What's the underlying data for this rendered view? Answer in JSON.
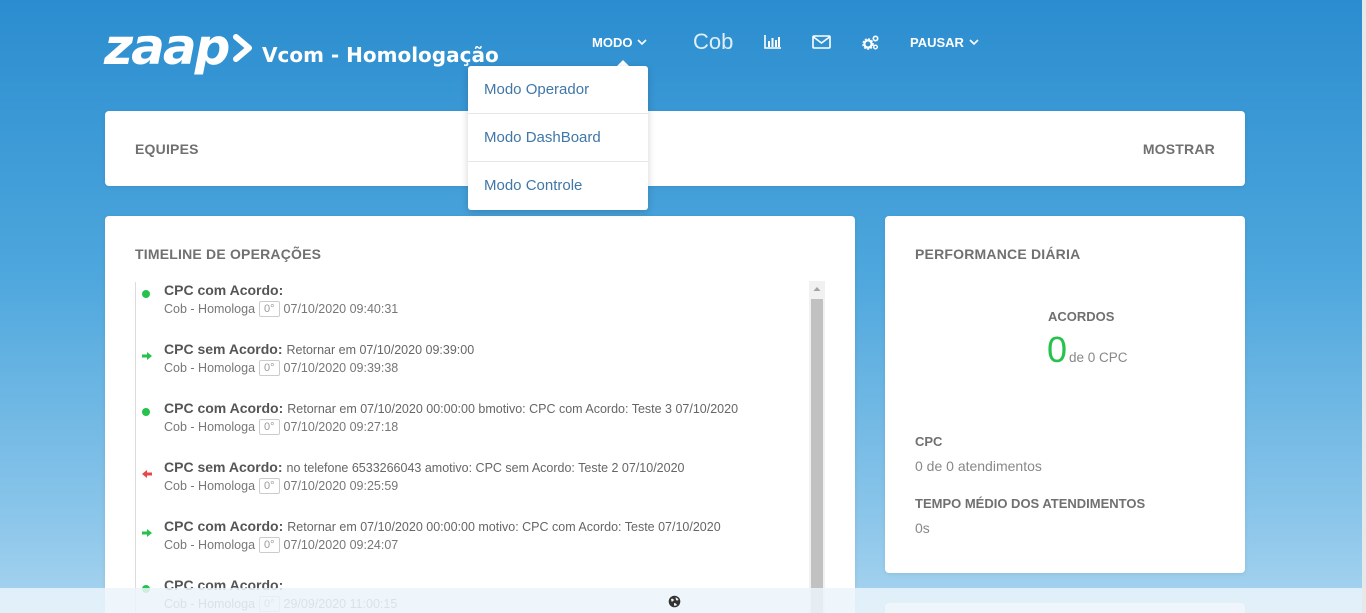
{
  "header": {
    "logo_text": "zaap",
    "app_title": "Vcom - Homologação",
    "modo_label": "MODO",
    "cob_label": "Cob",
    "pausar_label": "PAUSAR",
    "icons": [
      "chart-icon",
      "mail-icon",
      "gears-icon",
      "chevron-down-icon"
    ]
  },
  "modo_dropdown": {
    "items": [
      "Modo Operador",
      "Modo DashBoard",
      "Modo Controle"
    ]
  },
  "equipes": {
    "title": "EQUIPES",
    "action": "MOSTRAR"
  },
  "timeline": {
    "title": "TIMELINE DE OPERAÇÕES",
    "items": [
      {
        "marker": "dot",
        "kind": "CPC com Acordo:",
        "desc": "",
        "who": "Cob - Homologa",
        "badge": "0°",
        "datetime": "07/10/2020 09:40:31"
      },
      {
        "marker": "arrow-right",
        "kind": "CPC sem Acordo:",
        "desc": "Retornar em 07/10/2020 09:39:00",
        "who": "Cob - Homologa",
        "badge": "0°",
        "datetime": "07/10/2020 09:39:38"
      },
      {
        "marker": "dot",
        "kind": "CPC com Acordo:",
        "desc": "Retornar em 07/10/2020 00:00:00 bmotivo: CPC com Acordo: Teste 3 07/10/2020",
        "who": "Cob - Homologa",
        "badge": "0°",
        "datetime": "07/10/2020 09:27:18"
      },
      {
        "marker": "arrow-left",
        "kind": "CPC sem Acordo:",
        "desc": "no telefone 6533266043 amotivo: CPC sem Acordo: Teste 2 07/10/2020",
        "who": "Cob - Homologa",
        "badge": "0°",
        "datetime": "07/10/2020 09:25:59"
      },
      {
        "marker": "arrow-right",
        "kind": "CPC com Acordo:",
        "desc": "Retornar em 07/10/2020 00:00:00 motivo: CPC com Acordo: Teste 07/10/2020",
        "who": "Cob - Homologa",
        "badge": "0°",
        "datetime": "07/10/2020 09:24:07"
      },
      {
        "marker": "dot",
        "kind": "CPC com Acordo:",
        "desc": "",
        "who": "Cob - Homologa",
        "badge": "0°",
        "datetime": "29/09/2020 11:00:15"
      }
    ]
  },
  "performance": {
    "title": "PERFORMANCE DIÁRIA",
    "acordos_label": "ACORDOS",
    "acordos_value": "0",
    "acordos_total": "de 0 CPC",
    "cpc_label": "CPC",
    "cpc_value": "0 de 0 atendimentos",
    "tma_label": "TEMPO MÉDIO DOS ATENDIMENTOS",
    "tma_value": "0s"
  },
  "colors": {
    "accent_green": "#27c24c",
    "arrow_red": "#e8474a",
    "link_blue": "#3f77a8"
  }
}
